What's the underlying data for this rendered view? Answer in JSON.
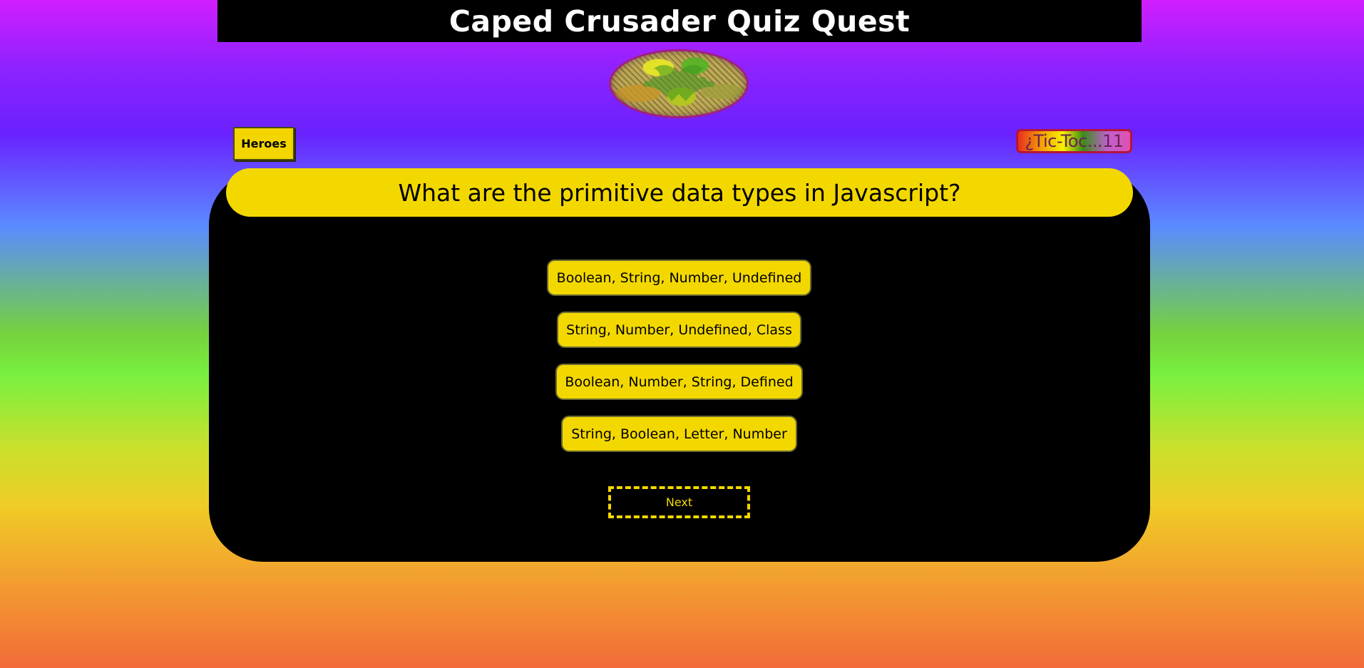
{
  "header": {
    "title": "Caped Crusader Quiz Quest"
  },
  "logo": {
    "icon": "bat-signal-icon"
  },
  "nav": {
    "heroes_label": "Heroes"
  },
  "timer": {
    "text": "¿Tic-Toc...11"
  },
  "question": {
    "text": "What are the primitive data types in Javascript?"
  },
  "answers": [
    {
      "label": "Boolean, String, Number, Undefined"
    },
    {
      "label": "String, Number, Undefined, Class"
    },
    {
      "label": "Boolean, Number, String, Defined"
    },
    {
      "label": "String, Boolean, Letter, Number"
    }
  ],
  "controls": {
    "next_label": "Next"
  },
  "colors": {
    "accent_yellow": "#f3d800",
    "card_black": "#000000",
    "header_black": "#000000"
  }
}
